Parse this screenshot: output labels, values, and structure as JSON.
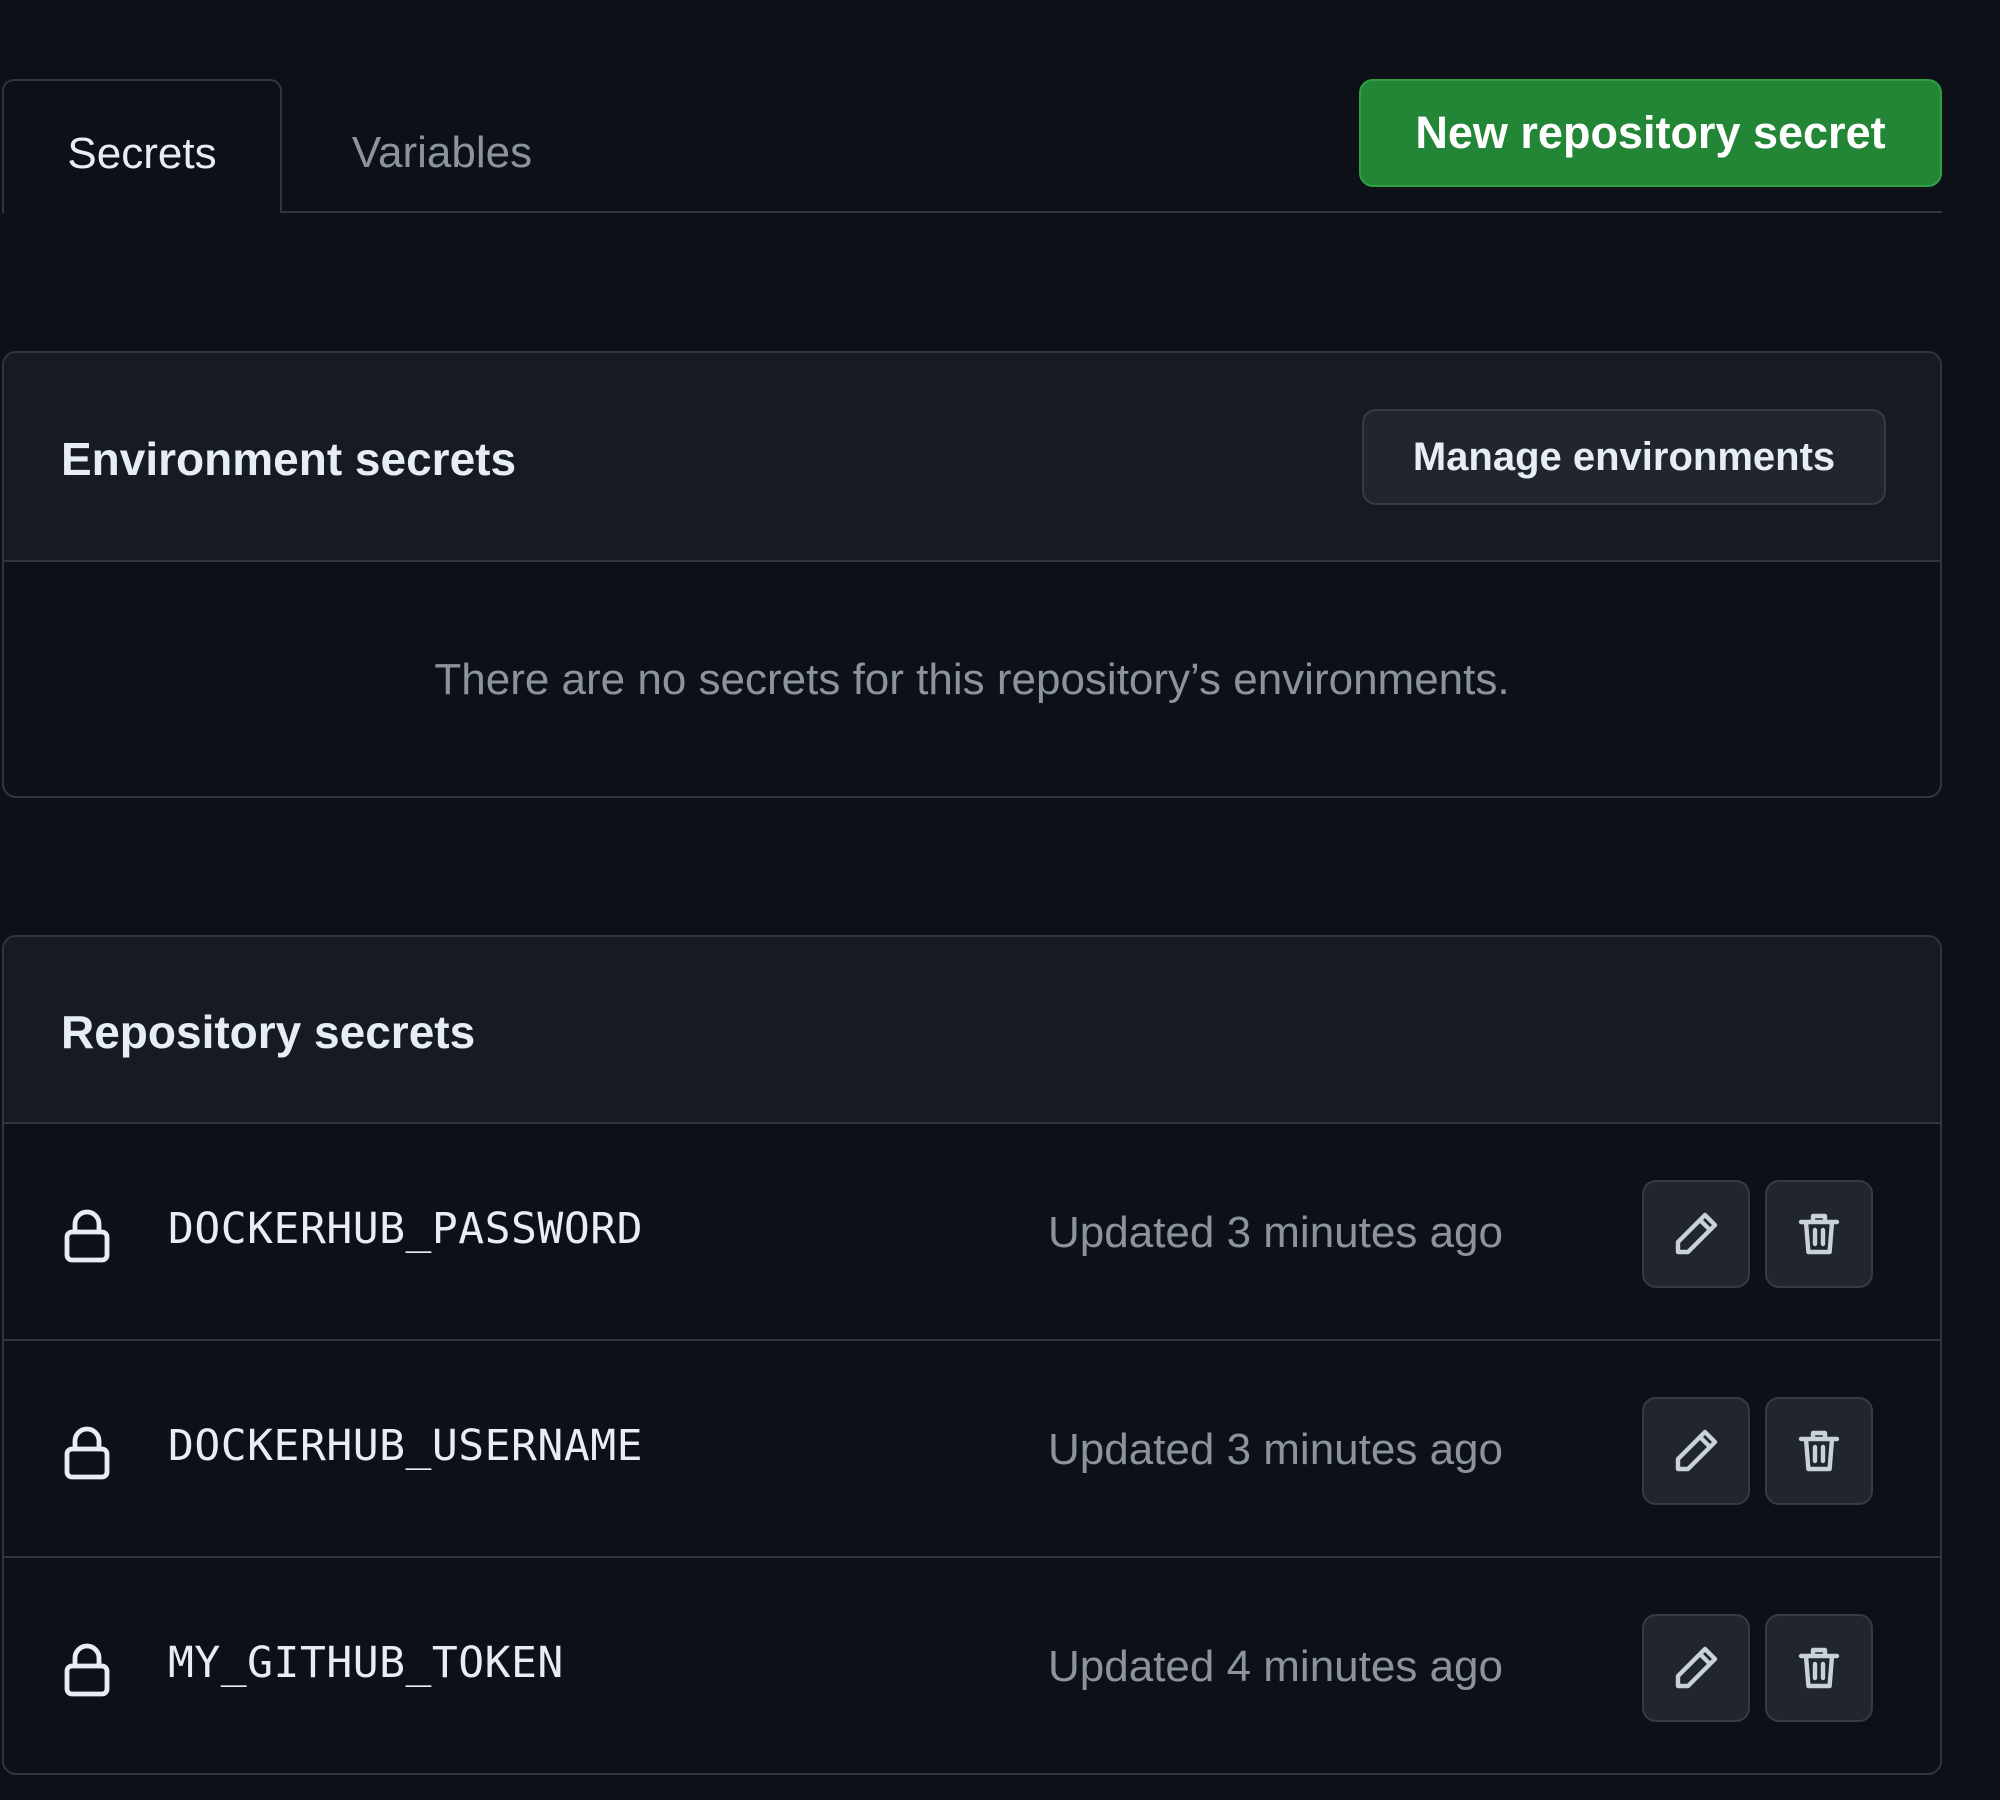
{
  "tabs": {
    "secrets_label": "Secrets",
    "variables_label": "Variables"
  },
  "actions": {
    "new_secret_label": "New repository secret"
  },
  "environment": {
    "title": "Environment secrets",
    "manage_label": "Manage environments",
    "empty_message": "There are no secrets for this repository’s environments."
  },
  "repository": {
    "title": "Repository secrets",
    "secrets": [
      {
        "name": "DOCKERHUB_PASSWORD",
        "updated": "Updated 3 minutes ago"
      },
      {
        "name": "DOCKERHUB_USERNAME",
        "updated": "Updated 3 minutes ago"
      },
      {
        "name": "MY_GITHUB_TOKEN",
        "updated": "Updated 4 minutes ago"
      }
    ]
  },
  "icons": {
    "row_icon": "lock-icon",
    "edit_icon": "pencil-icon",
    "delete_icon": "trash-icon"
  },
  "colors": {
    "background": "#0d1117",
    "panel_header": "#161b22",
    "border": "#30363d",
    "primary_button": "#238636",
    "muted_text": "#8b949e"
  }
}
